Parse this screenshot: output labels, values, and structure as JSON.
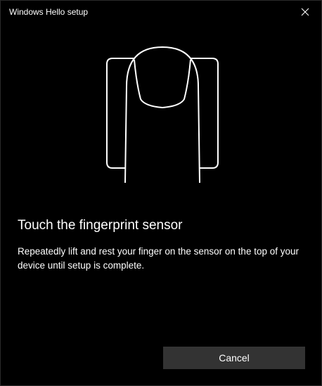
{
  "window": {
    "title": "Windows Hello setup",
    "close_icon": "close-icon"
  },
  "illustration": {
    "icon": "finger-on-sensor-icon"
  },
  "content": {
    "heading": "Touch the fingerprint sensor",
    "description": "Repeatedly lift and rest your finger on the sensor on the top of your device until setup is complete."
  },
  "footer": {
    "cancel_label": "Cancel"
  },
  "colors": {
    "background": "#000000",
    "button_background": "#333333",
    "text": "#ffffff"
  }
}
